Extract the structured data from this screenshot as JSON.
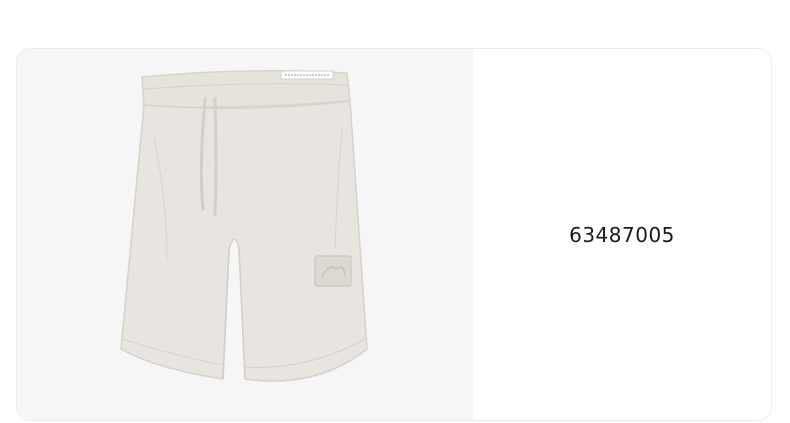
{
  "product": {
    "image_alt": "product-image",
    "code": "63487005"
  },
  "colors": {
    "image_background": "#f6f6f6",
    "garment": "#e8e4df",
    "text": "#1a1a1a"
  }
}
